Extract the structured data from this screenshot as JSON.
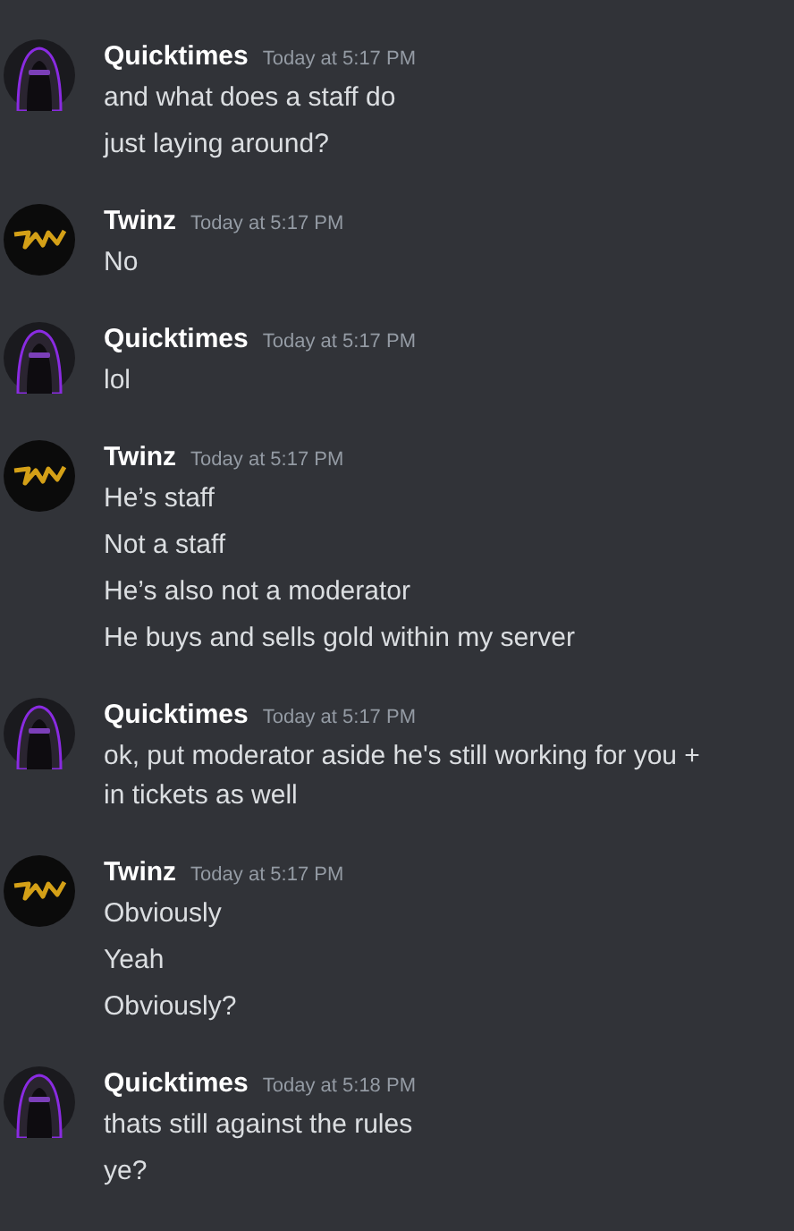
{
  "messages": [
    {
      "author": "Quicktimes",
      "avatar": {
        "kind": "hooded"
      },
      "time": "Today at 5:17 PM",
      "lines": [
        "and what does a staff do",
        "just laying around?"
      ]
    },
    {
      "author": "Twinz",
      "avatar": {
        "kind": "logo"
      },
      "time": "Today at 5:17 PM",
      "lines": [
        "No"
      ]
    },
    {
      "author": "Quicktimes",
      "avatar": {
        "kind": "hooded"
      },
      "time": "Today at 5:17 PM",
      "lines": [
        "lol"
      ]
    },
    {
      "author": "Twinz",
      "avatar": {
        "kind": "logo"
      },
      "time": "Today at 5:17 PM",
      "lines": [
        "He’s staff",
        "Not a staff",
        "He’s also not a moderator",
        "He buys and sells gold within my server"
      ]
    },
    {
      "author": "Quicktimes",
      "avatar": {
        "kind": "hooded"
      },
      "time": "Today at 5:17 PM",
      "lines": [
        "ok, put moderator aside he's still working for you + in tickets as well"
      ]
    },
    {
      "author": "Twinz",
      "avatar": {
        "kind": "logo"
      },
      "time": "Today at 5:17 PM",
      "lines": [
        "Obviously",
        "Yeah",
        "Obviously?"
      ]
    },
    {
      "author": "Quicktimes",
      "avatar": {
        "kind": "hooded"
      },
      "time": "Today at 5:18 PM",
      "lines": [
        "thats still against the rules",
        "ye?"
      ]
    }
  ]
}
